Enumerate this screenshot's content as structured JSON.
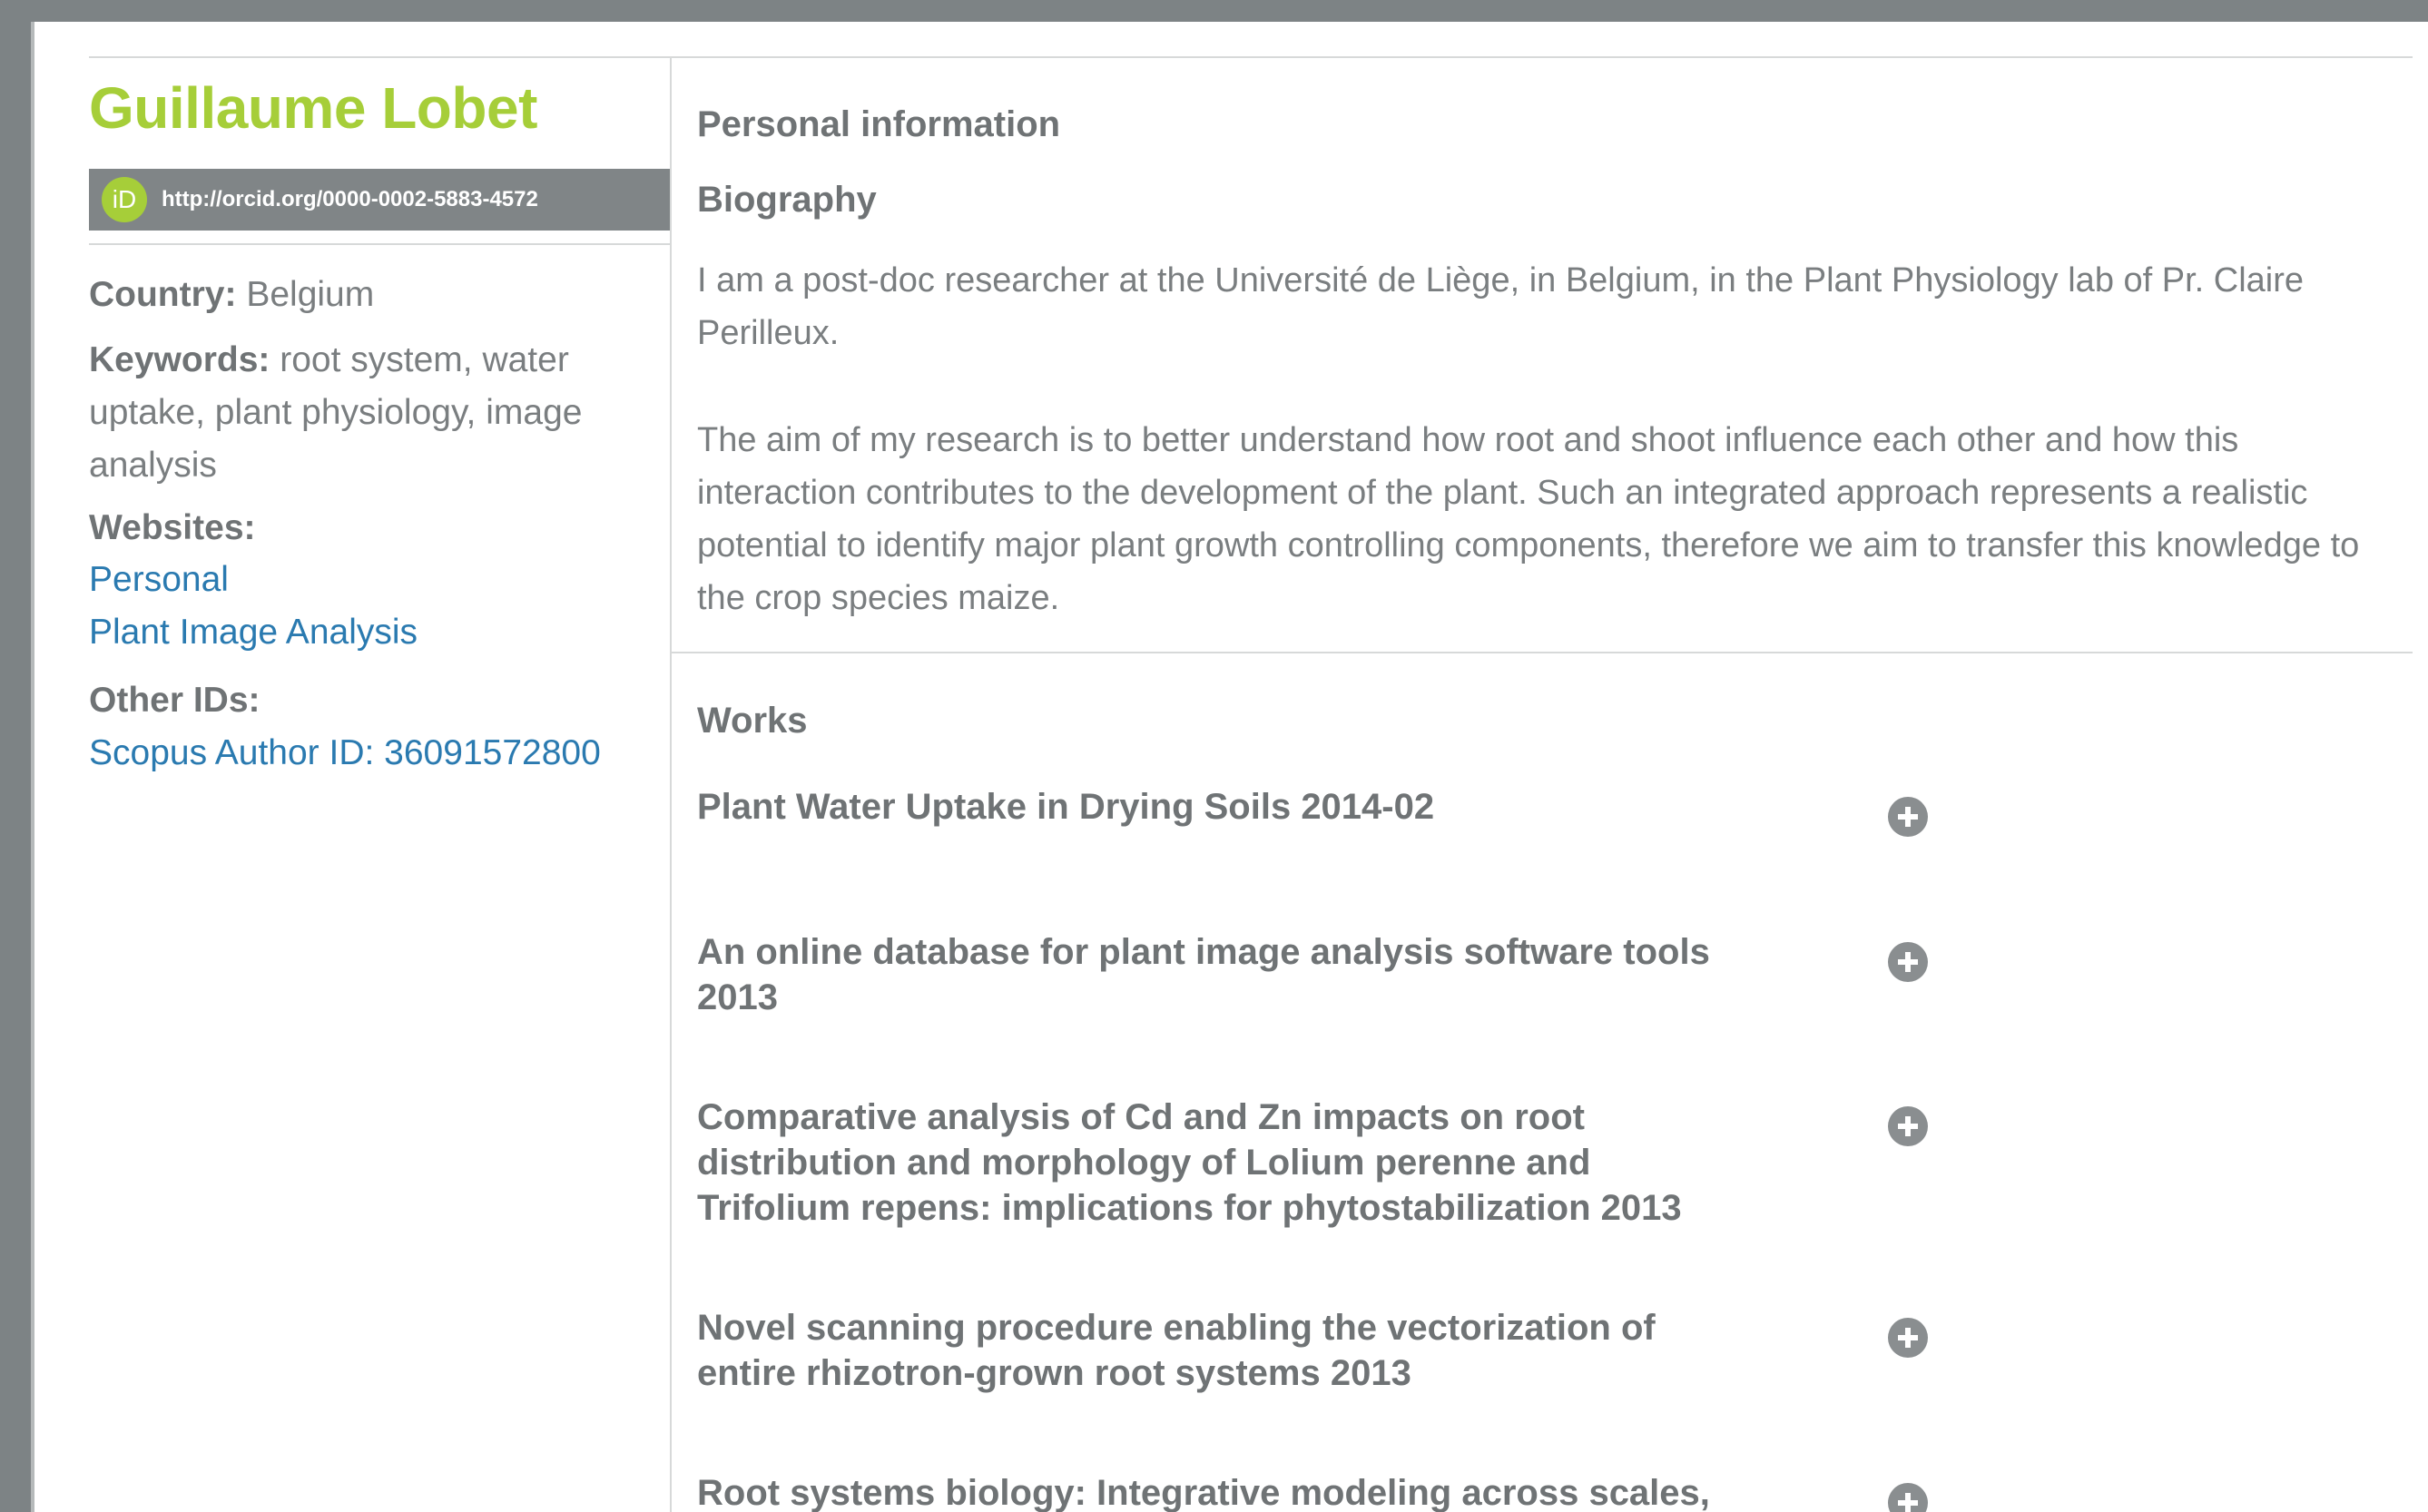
{
  "profile": {
    "name": "Guillaume Lobet",
    "orcid_badge": "iD",
    "orcid_url": "http://orcid.org/0000-0002-5883-4572",
    "country_label": "Country:",
    "country_value": "Belgium",
    "keywords_label": "Keywords:",
    "keywords_value": "root system, water uptake, plant physiology, image analysis",
    "websites_label": "Websites:",
    "websites": [
      "Personal",
      "Plant Image Analysis"
    ],
    "other_ids_label": "Other IDs:",
    "other_ids": [
      "Scopus Author ID: 36091572800"
    ]
  },
  "main": {
    "personal_info_heading": "Personal information",
    "biography_heading": "Biography",
    "biography_paragraphs": [
      "I am a post-doc researcher at the Université de Liège, in Belgium, in the Plant Physiology lab of Pr. Claire Perilleux.",
      "The aim of my research is to better understand how root and shoot influence each other and how this interaction contributes to the development of the plant. Such an integrated approach represents a realistic potential to identify major plant growth controlling components, therefore we aim to transfer this knowledge to the crop species maize."
    ],
    "works_heading": "Works",
    "works": [
      "Plant Water Uptake in Drying Soils 2014-02",
      "An online database for plant image analysis software tools 2013",
      "Comparative analysis of Cd and Zn impacts on root distribution and morphology of Lolium perenne and Trifolium repens: implications for phytostabilization 2013",
      "Novel scanning procedure enabling the vectorization of entire rhizotron-grown root systems 2013",
      "Root systems biology: Integrative modeling across scales,"
    ]
  },
  "icons": {
    "expand": "plus-circle-icon",
    "orcid": "orcid-id-icon"
  },
  "colors": {
    "brand_green": "#a6ce39",
    "link_blue": "#2a7ab0",
    "text_gray": "#7a7e80",
    "frame_gray": "#7d8385"
  }
}
